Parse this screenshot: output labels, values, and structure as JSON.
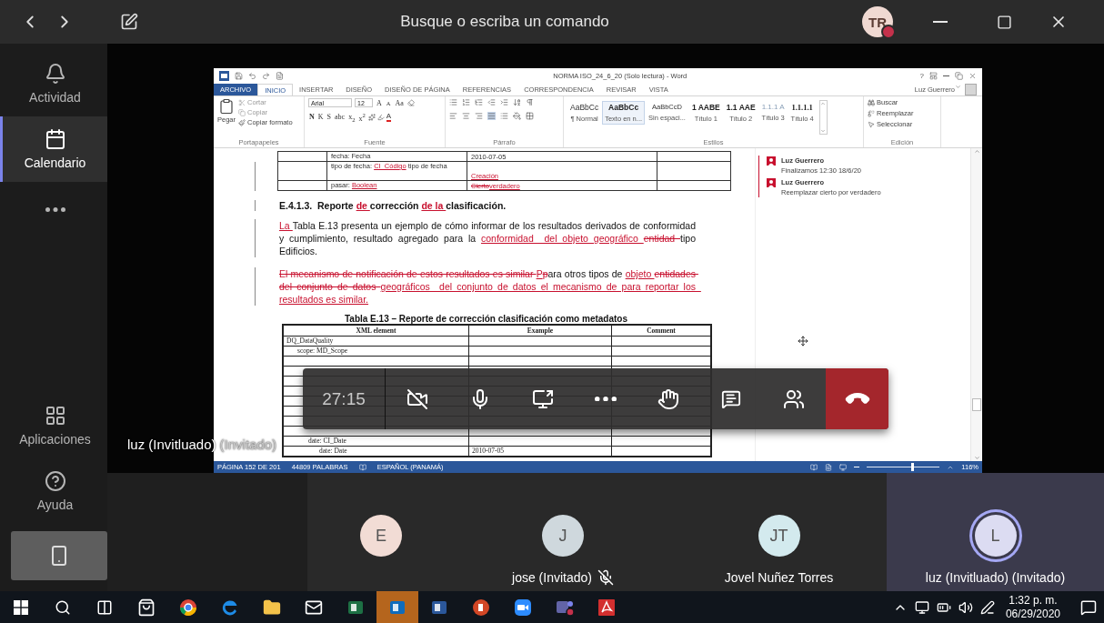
{
  "top_bar": {
    "search_placeholder": "Busque o escriba un comando",
    "avatar_initials": "TR"
  },
  "rail": {
    "top": [
      {
        "kind": "labeled",
        "label": "Actividad",
        "selected": false
      },
      {
        "kind": "labeled",
        "label": "Calendario",
        "selected": true
      },
      {
        "kind": "more",
        "selected": false
      }
    ],
    "bottom": [
      {
        "kind": "labeled",
        "label": "Aplicaciones",
        "selected": false
      },
      {
        "kind": "labeled",
        "label": "Ayuda",
        "selected": false
      },
      {
        "kind": "device",
        "selected": false
      }
    ]
  },
  "word": {
    "title": "NORMA ISO_24_6_20 (Solo lectura) - Word",
    "help": "?",
    "tabs": [
      {
        "kind": "file",
        "label": "ARCHIVO",
        "selected": false
      },
      {
        "kind": "tab",
        "label": "INICIO",
        "selected": true
      },
      {
        "kind": "tab",
        "label": "INSERTAR",
        "selected": false
      },
      {
        "kind": "tab",
        "label": "DISEÑO",
        "selected": false
      },
      {
        "kind": "tab",
        "label": "DISEÑO DE PÁGINA",
        "selected": false
      },
      {
        "kind": "tab",
        "label": "REFERENCIAS",
        "selected": false
      },
      {
        "kind": "tab",
        "label": "CORRESPONDENCIA",
        "selected": false
      },
      {
        "kind": "tab",
        "label": "REVISAR",
        "selected": false
      },
      {
        "kind": "tab",
        "label": "VISTA",
        "selected": false
      }
    ],
    "account": "Luz Guerrero",
    "ribbon": {
      "clipboard": {
        "paste": "Pegar",
        "label": "Portapapeles",
        "actions": [
          {
            "label": "Cortar",
            "disabled": true
          },
          {
            "label": "Copiar",
            "disabled": true
          },
          {
            "label": "Copiar formato",
            "disabled": false
          }
        ]
      },
      "font": {
        "family": "Arial",
        "size": "12",
        "grow": "A",
        "shrink": "A",
        "case": "Aa",
        "format": [
          "N",
          "K",
          "S",
          "abc",
          "x$_{2}$",
          "x$^{2}$"
        ],
        "color_label": "A",
        "label": "Fuente"
      },
      "paragraph": {
        "label": "Párrafo"
      },
      "styles": {
        "label": "Estilos",
        "items": [
          {
            "kind": "body",
            "preview": "AaBbCc",
            "name": "¶ Normal",
            "selected": false
          },
          {
            "kind": "strong",
            "preview": "AaBbCc",
            "name": "Texto en n...",
            "selected": true
          },
          {
            "kind": "compact",
            "preview": "AaBbCcD",
            "name": "Sin espaci...",
            "selected": false
          },
          {
            "kind": "heading",
            "preview": "1 AABE",
            "name": "Título 1",
            "selected": false
          },
          {
            "kind": "heading",
            "preview": "1.1 AAE",
            "name": "Título 2",
            "selected": false
          },
          {
            "kind": "muted",
            "preview": "1.1.1 A",
            "name": "Título 3",
            "selected": false
          },
          {
            "kind": "serif",
            "preview": "1.1.1.1",
            "name": "Título 4",
            "selected": false
          }
        ]
      },
      "editing": {
        "label": "Edición",
        "actions": [
          "Buscar",
          "Reemplazar",
          "Seleccionar"
        ]
      }
    },
    "top_table": [
      {
        "column_2": [
          {
            "kind": "plain",
            "text": "fecha: Fecha"
          }
        ],
        "column_3": [
          {
            "kind": "plain",
            "text": "2010-07-05"
          }
        ]
      },
      {
        "column_2": [
          {
            "kind": "plain",
            "text": "tipo de fecha: "
          },
          {
            "kind": "inserted",
            "text": "CI_Código"
          },
          {
            "kind": "plain",
            "text": " tipo de fecha"
          }
        ],
        "column_3": [
          {
            "kind": "inserted",
            "text": "Creación"
          }
        ]
      },
      {
        "column_2": [
          {
            "kind": "plain",
            "text": "pasar: "
          },
          {
            "kind": "inserted",
            "text": "Boolean"
          }
        ],
        "column_3": [
          {
            "kind": "deleted",
            "text": "Cierto"
          },
          {
            "kind": "inserted",
            "text": "verdadero"
          }
        ]
      }
    ],
    "heading": [
      {
        "kind": "plain",
        "text": "E.4.1.3.  Reporte "
      },
      {
        "kind": "inserted",
        "text": "de "
      },
      {
        "kind": "plain",
        "text": "corrección "
      },
      {
        "kind": "inserted",
        "text": "de la "
      },
      {
        "kind": "plain",
        "text": "clasificación."
      }
    ],
    "paragraphs": [
      [
        {
          "kind": "inserted",
          "text": "La "
        },
        {
          "kind": "plain",
          "text": "Tabla E.13 presenta un ejemplo de cómo informar de los resultados derivados de conformidad y cumplimiento, resultado agregado para la "
        },
        {
          "kind": "inserted",
          "text": "conformidad  del objeto geográfico "
        },
        {
          "kind": "deleted",
          "text": "entidad "
        },
        {
          "kind": "plain",
          "text": "tipo Edificios."
        }
      ],
      [
        {
          "kind": "deleted",
          "text": "El mecanismo de notificación de estos resultados es similar "
        },
        {
          "kind": "inserted",
          "text": "P"
        },
        {
          "kind": "deleted",
          "text": "p"
        },
        {
          "kind": "plain",
          "text": "ara otros tipos de "
        },
        {
          "kind": "inserted",
          "text": "objeto "
        },
        {
          "kind": "deleted",
          "text": "entidades del conjunto de datos "
        },
        {
          "kind": "inserted",
          "text": "geográficos  del conjunto de datos el mecanismo de para reportar los  resultados es similar."
        }
      ]
    ],
    "caption": "Tabla E.13 – Reporte de corrección clasificación como metadatos",
    "xml_table": {
      "columns": [
        "XML element",
        "Example",
        "Comment"
      ],
      "rows": [
        {
          "kind": "row",
          "element": "DQ_DataQuality",
          "children": [
            {
              "kind": "row",
              "element": "scope: MD_Scope"
            },
            {
              "kind": "obscured"
            },
            {
              "kind": "obscured"
            },
            {
              "kind": "obscured"
            },
            {
              "kind": "obscured"
            },
            {
              "kind": "obscured"
            },
            {
              "kind": "obscured"
            },
            {
              "kind": "obscured"
            },
            {
              "kind": "obscured",
              "children": [
                {
                  "kind": "row",
                  "element": "date: CI_Date",
                  "children": [
                    {
                      "kind": "row",
                      "element": "date: Date",
                      "example": "2010-07-05"
                    }
                  ]
                }
              ]
            }
          ]
        }
      ]
    },
    "comments": [
      {
        "author": "Luz Guerrero",
        "text": "Finalizamos 12:30 18/6/20"
      },
      {
        "author": "Luz Guerrero",
        "text": "Reemplazar cierto por verdadero"
      }
    ],
    "status_bar": {
      "page": "PÁGINA 152 DE 201",
      "words": "44809 PALABRAS",
      "language": "ESPAÑOL (PANAMÁ)",
      "zoom": "116%",
      "zoom_slider": {
        "level": 0.62
      }
    }
  },
  "presenter": {
    "name": "luz (Invitluado)",
    "role": "(Invitado)"
  },
  "call_controls": {
    "timer": "27:15",
    "camera_on": false,
    "mic_muted": false
  },
  "participants": [
    {
      "initials": "E",
      "color": "#f2dcd5",
      "speaking": false
    },
    {
      "initials": "J",
      "color": "#cfd8dd",
      "name": "jose (Invitado)",
      "muted": true,
      "speaking": false
    },
    {
      "initials": "JT",
      "color": "#d3eaee",
      "name": "Jovel Nuñez Torres",
      "muted": false,
      "speaking": false
    },
    {
      "initials": "L",
      "color": "#dcdcf2",
      "name": "luz (Invitluado) (Invitado)",
      "muted": false,
      "speaking": true
    }
  ],
  "taskbar": {
    "apps": [
      {
        "selected": false
      },
      {
        "selected": false
      },
      {
        "selected": false
      },
      {
        "selected": false
      },
      {
        "selected": false
      },
      {
        "selected": false
      },
      {
        "selected": false
      },
      {
        "selected": false
      },
      {
        "selected": false
      },
      {
        "selected": true
      },
      {
        "selected": false
      },
      {
        "selected": false
      },
      {
        "selected": false
      },
      {
        "selected": false
      },
      {
        "selected": false
      }
    ],
    "time": "1:32 p. m.",
    "date": "06/29/2020"
  }
}
